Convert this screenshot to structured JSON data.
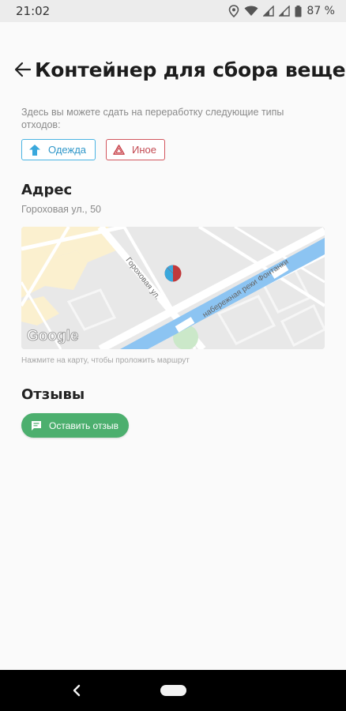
{
  "status_bar": {
    "time": "21:02",
    "battery": "87 %",
    "icons": [
      "location-icon",
      "wifi-icon",
      "cell-signal-icon",
      "cell-signal-icon",
      "battery-icon"
    ]
  },
  "header": {
    "back_icon": "arrow-left-icon",
    "title": "Контейнер для сбора вещей"
  },
  "intro_text": "Здесь вы можете сдать на переработку следующие типы отходов:",
  "waste_types": [
    {
      "label": "Одежда",
      "icon": "shirt-arrow-icon",
      "color": "#4ab4e3"
    },
    {
      "label": "Иное",
      "icon": "triangle-warning-icon",
      "color": "#d2565e"
    }
  ],
  "address": {
    "title": "Адрес",
    "value": "Гороховая ул., 50"
  },
  "map": {
    "street_label": "Гороховая ул.",
    "embankment_label": "набережная реки Фонтанки",
    "provider": "Google",
    "hint": "Нажмите на карту, чтобы проложить маршрут",
    "colors": {
      "water": "#8cc4f2",
      "park": "#cbe8c9",
      "land": "#e8e8e8",
      "block": "#fbf0cf",
      "road": "#ffffff"
    },
    "marker_colors": [
      "#3aa8dc",
      "#c0393b"
    ]
  },
  "reviews": {
    "title": "Отзывы",
    "button_label": "Оставить отзыв",
    "button_icon": "comment-icon",
    "button_color": "#4caf6e"
  },
  "nav_bar": {
    "back_icon": "nav-back-icon",
    "home_icon": "nav-home-pill"
  }
}
